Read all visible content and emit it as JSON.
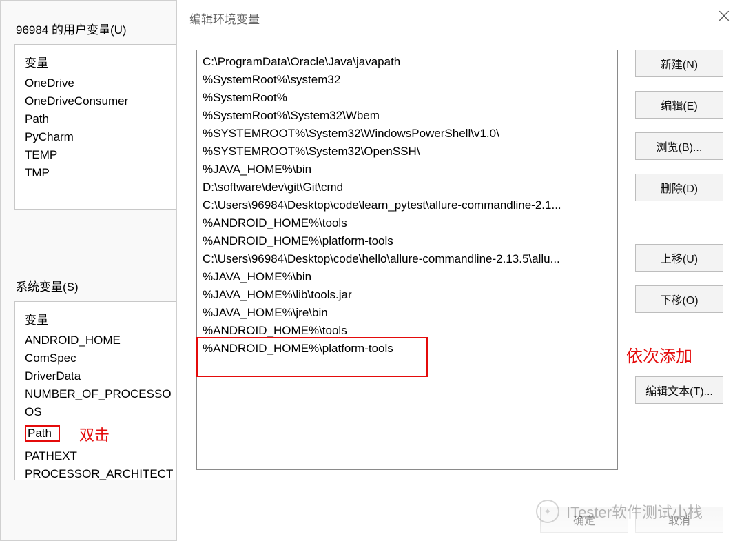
{
  "base": {
    "user_vars_label": "96984 的用户变量(U)",
    "user_vars_header": "变量",
    "user_vars": [
      "OneDrive",
      "OneDriveConsumer",
      "Path",
      "PyCharm",
      "TEMP",
      "TMP"
    ],
    "sys_vars_label": "系统变量(S)",
    "sys_vars_header": "变量",
    "sys_vars": [
      "ANDROID_HOME",
      "ComSpec",
      "DriverData",
      "NUMBER_OF_PROCESSO",
      "OS",
      "Path",
      "PATHEXT",
      "PROCESSOR_ARCHITECT"
    ],
    "annotation_doubleclick": "双击",
    "selected_sys_var": "Path"
  },
  "dialog": {
    "title": "编辑环境变量",
    "entries": [
      "C:\\ProgramData\\Oracle\\Java\\javapath",
      "%SystemRoot%\\system32",
      "%SystemRoot%",
      "%SystemRoot%\\System32\\Wbem",
      "%SYSTEMROOT%\\System32\\WindowsPowerShell\\v1.0\\",
      "%SYSTEMROOT%\\System32\\OpenSSH\\",
      "%JAVA_HOME%\\bin",
      "D:\\software\\dev\\git\\Git\\cmd",
      "C:\\Users\\96984\\Desktop\\code\\learn_pytest\\allure-commandline-2.1...",
      "%ANDROID_HOME%\\tools",
      "%ANDROID_HOME%\\platform-tools",
      "C:\\Users\\96984\\Desktop\\code\\hello\\allure-commandline-2.13.5\\allu...",
      "%JAVA_HOME%\\bin",
      "%JAVA_HOME%\\lib\\tools.jar",
      "%JAVA_HOME%\\jre\\bin",
      "%ANDROID_HOME%\\tools",
      "%ANDROID_HOME%\\platform-tools"
    ],
    "annotation_add": "依次添加",
    "buttons": {
      "new": "新建(N)",
      "edit": "编辑(E)",
      "browse": "浏览(B)...",
      "delete": "删除(D)",
      "moveup": "上移(U)",
      "movedown": "下移(O)",
      "edittext": "编辑文本(T)..."
    },
    "footer": {
      "ok": "确定",
      "cancel": "取消"
    }
  },
  "watermark": "ITester软件测试小栈"
}
